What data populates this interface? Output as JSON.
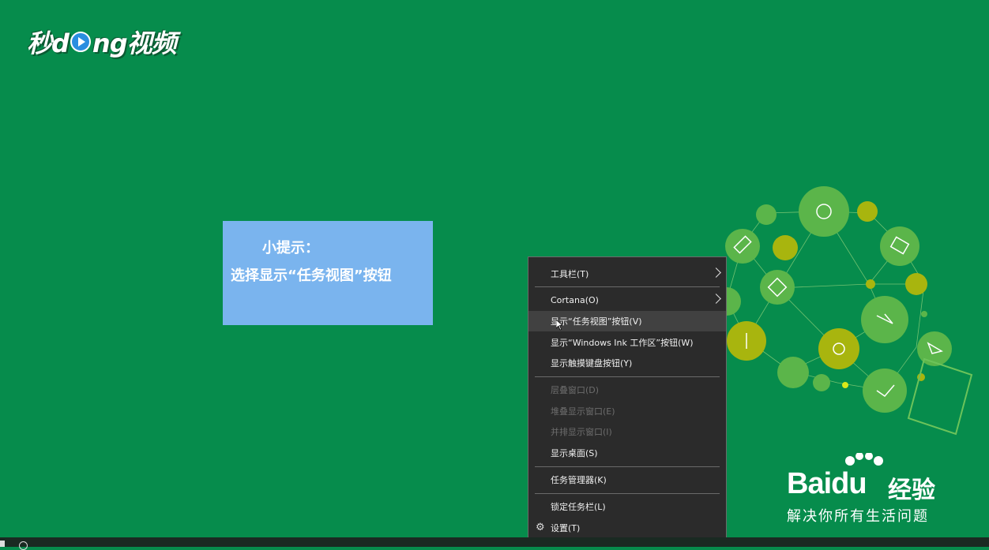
{
  "watermark": {
    "logo_text_1": "秒d",
    "logo_text_2": "ng视频"
  },
  "tip": {
    "title": "小提示：",
    "body": "选择显示“任务视图”按钮"
  },
  "context_menu": {
    "items": [
      {
        "label": "工具栏(T)",
        "submenu": true,
        "enabled": true
      },
      {
        "label": "Cortana(O)",
        "submenu": true,
        "enabled": true
      },
      {
        "label": "显示“任务视图”按钮(V)",
        "enabled": true,
        "highlighted": true
      },
      {
        "label": "显示“Windows Ink 工作区”按钮(W)",
        "enabled": true
      },
      {
        "label": "显示触摸键盘按钮(Y)",
        "enabled": true
      },
      {
        "label": "层叠窗口(D)",
        "enabled": false
      },
      {
        "label": "堆叠显示窗口(E)",
        "enabled": false
      },
      {
        "label": "并排显示窗口(I)",
        "enabled": false
      },
      {
        "label": "显示桌面(S)",
        "enabled": true
      },
      {
        "label": "任务管理器(K)",
        "enabled": true
      },
      {
        "label": "锁定任务栏(L)",
        "enabled": true
      },
      {
        "label": "设置(T)",
        "enabled": true,
        "icon": "gear-icon"
      }
    ]
  },
  "baidu": {
    "brand": "Bai",
    "brand_du": "du",
    "brand_cn": "经验",
    "slogan": "解决你所有生活问题"
  },
  "colors": {
    "background": "#068c4c",
    "tip_bg": "#7ab4ee",
    "menu_bg": "#2b2b2b",
    "menu_hover": "#414141"
  }
}
